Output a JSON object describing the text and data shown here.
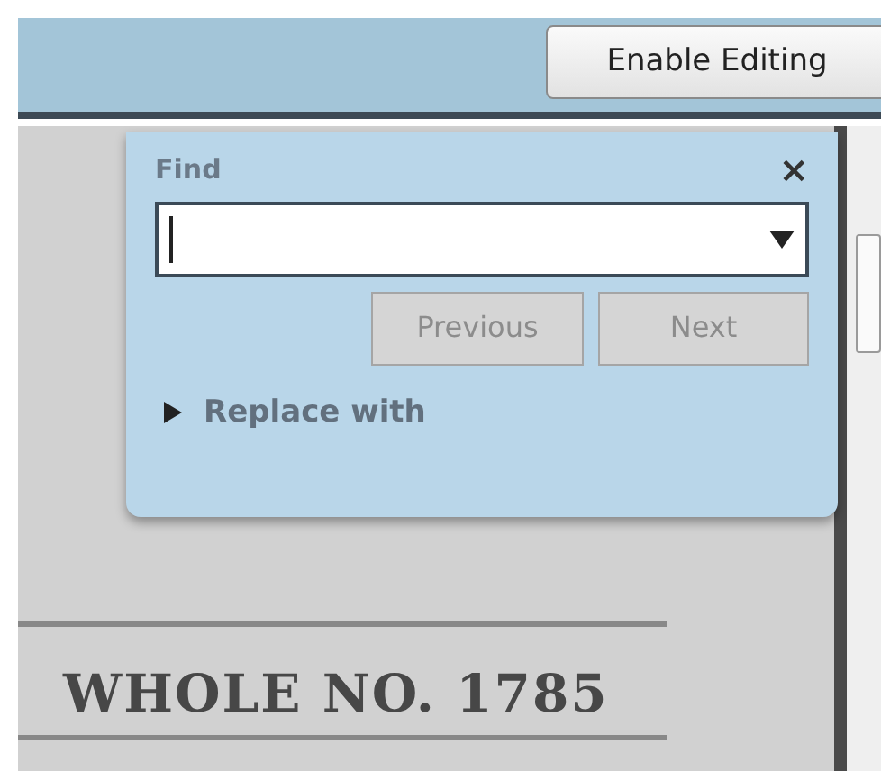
{
  "toolbar": {
    "button": "Enable Editing"
  },
  "find_pane": {
    "title": "Find",
    "close": "×",
    "buttons": [
      {
        "label": "Previous",
        "disabled": true
      },
      {
        "label": "Next",
        "disabled": true
      }
    ],
    "replace": {
      "label": "Replace with",
      "expanded": false
    }
  },
  "document": {
    "text": "WHOLE NO. 1785"
  }
}
